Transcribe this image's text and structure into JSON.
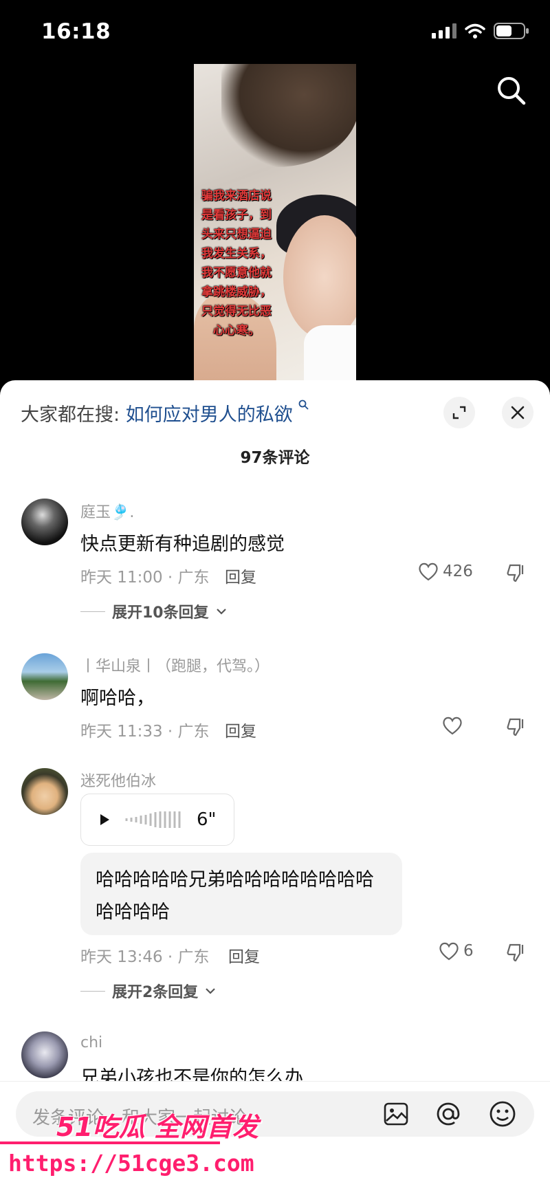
{
  "status_bar": {
    "time": "16:18"
  },
  "video": {
    "caption_lines": [
      "骗我来酒店说",
      "是看孩子，到",
      "头来只想逼迫",
      "我发生关系，",
      "我不愿意他就",
      "拿跳楼威胁，",
      "只觉得无比恶",
      "心心寒。"
    ]
  },
  "panel": {
    "trend_label": "大家都在搜:",
    "trend_keyword": "如何应对男人的私欲",
    "comment_count": "97条评论"
  },
  "comments": [
    {
      "username": "庭玉🎐.",
      "text": "快点更新有种追剧的感觉",
      "meta": "昨天 11:00 · 广东",
      "reply": "回复",
      "likes": "426",
      "expand": "展开10条回复"
    },
    {
      "username": "丨华山泉丨（跑腿，代驾。）",
      "text": "啊哈哈，",
      "meta": "昨天 11:33 · 广东",
      "reply": "回复",
      "likes": ""
    },
    {
      "username": "迷死他伯冰",
      "voice_duration": "6\"",
      "text": "哈哈哈哈哈兄弟哈哈哈哈哈哈哈哈哈哈哈哈",
      "meta": "昨天 13:46 · 广东",
      "reply": "回复",
      "likes": "6",
      "expand": "展开2条回复"
    },
    {
      "username": "chi",
      "text": "兄弟小孩也不是你的怎么办"
    }
  ],
  "composer": {
    "placeholder": "发条评论，和大家一起讨论"
  },
  "watermark": {
    "line1": "51吃瓜 全网首发",
    "line2": "https://51cge3.com"
  },
  "colors": {
    "accent_link": "#1f4f8f",
    "watermark": "#ff1e6e",
    "caption": "#e23a3a"
  }
}
